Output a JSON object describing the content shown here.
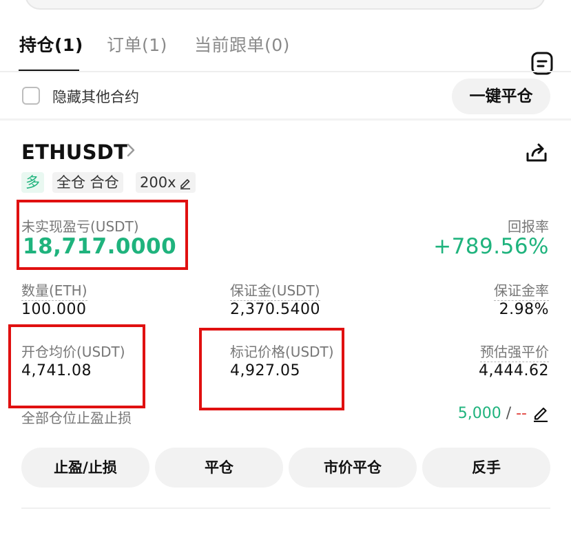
{
  "tabs": [
    {
      "label": "持仓(1)",
      "active": true
    },
    {
      "label": "订单(1)",
      "active": false
    },
    {
      "label": "当前跟单(0)",
      "active": false
    }
  ],
  "hide_other": {
    "label": "隐藏其他合约",
    "checked": false
  },
  "close_all_label": "一键平仓",
  "position": {
    "symbol": "ETHUSDT",
    "tags": {
      "side": "多",
      "mode": "全仓 合仓",
      "leverage": "200x"
    },
    "unrealized_pnl_label": "未实现盈亏(USDT)",
    "unrealized_pnl_value": "18,717.0000",
    "roe_label": "回报率",
    "roe_value": "+789.56%",
    "qty_label": "数量(ETH)",
    "qty_value": "100.000",
    "margin_label": "保证金(USDT)",
    "margin_value": "2,370.5400",
    "margin_ratio_label": "保证金率",
    "margin_ratio_value": "2.98%",
    "entry_label": "开仓均价(USDT)",
    "entry_value": "4,741.08",
    "mark_label": "标记价格(USDT)",
    "mark_value": "4,927.05",
    "liq_label": "预估强平价",
    "liq_value": "4,444.62",
    "tpsl_label": "全部仓位止盈止损",
    "tpsl_tp": "5,000",
    "tpsl_sep": "/",
    "tpsl_sl": "--"
  },
  "actions": [
    "止盈/止损",
    "平仓",
    "市价平仓",
    "反手"
  ],
  "colors": {
    "profit": "#1fb37d",
    "loss": "#e0403a",
    "highlight": "#e01010"
  },
  "icons": [
    "document-icon",
    "chevron-right-icon",
    "share-icon",
    "edit-icon"
  ]
}
